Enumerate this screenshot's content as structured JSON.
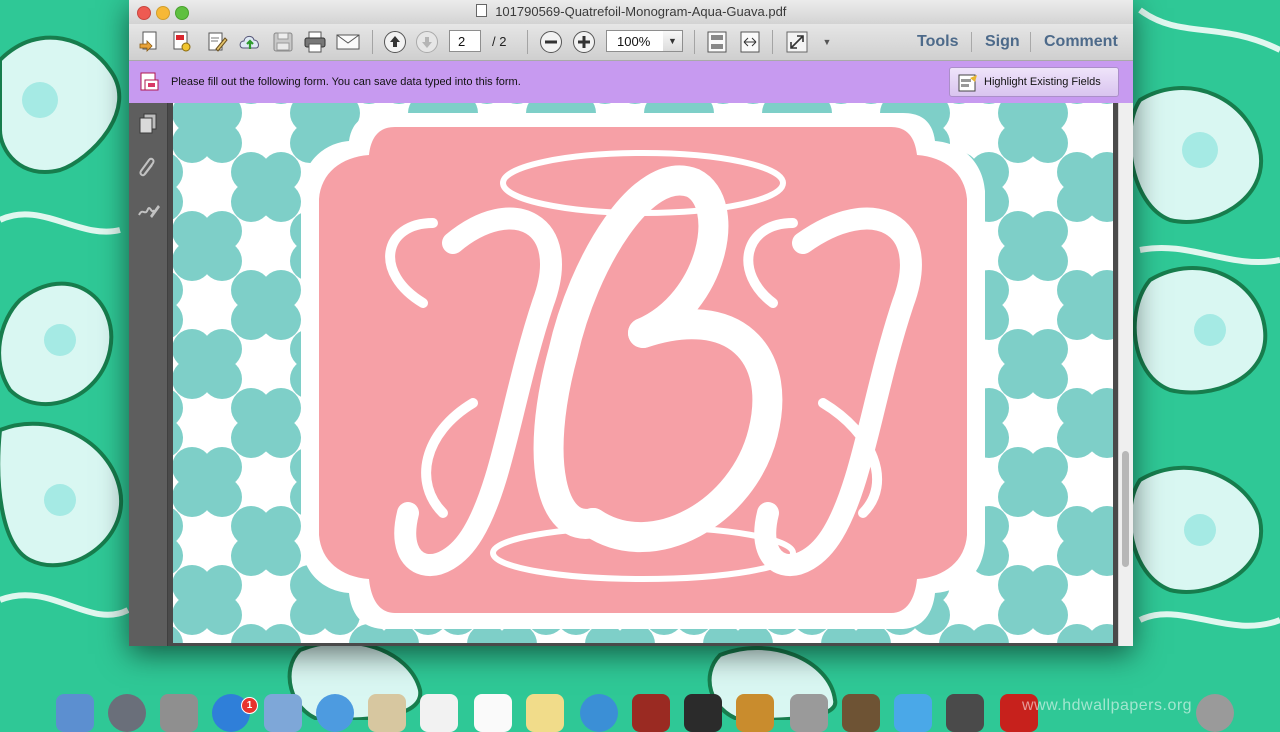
{
  "window": {
    "title": "101790569-Quatrefoil-Monogram-Aqua-Guava.pdf"
  },
  "toolbar": {
    "current_page": "2",
    "page_separator": "/ 2",
    "zoom": "100%",
    "tools_label": "Tools",
    "sign_label": "Sign",
    "comment_label": "Comment"
  },
  "formbar": {
    "message": "Please fill out the following form. You can save data typed into this form.",
    "highlight_label": "Highlight Existing Fields"
  },
  "document": {
    "monogram": "JBJ"
  },
  "dock": {
    "badge_count": "1"
  },
  "watermark": "www.hdwallpapers.org",
  "colors": {
    "aqua": "#7ecfc8",
    "guava": "#f6a0a6",
    "form_bar": "#c79af0",
    "wallpaper_green": "#2fc896"
  }
}
